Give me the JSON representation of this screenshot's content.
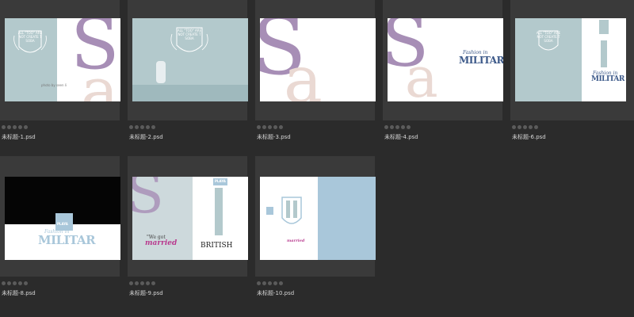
{
  "files": [
    {
      "name": "未标题-1.psd",
      "rating": 0
    },
    {
      "name": "未标题-2.psd",
      "rating": 0
    },
    {
      "name": "未标题-3.psd",
      "rating": 0
    },
    {
      "name": "未标题-4.psd",
      "rating": 0
    },
    {
      "name": "未标题-6.psd",
      "rating": 0
    },
    {
      "name": "未标题-8.psd",
      "rating": 0
    },
    {
      "name": "未标题-9.psd",
      "rating": 0
    },
    {
      "name": "未标题-10.psd",
      "rating": 0
    }
  ],
  "thumb_text": {
    "crest_line": "ALL \"TOO\" ARE NOT CREATE T SOBA",
    "military": "MILITAR",
    "fashion": "Fashion in",
    "playa": "PLAYA",
    "married": "married",
    "we_got": "\"We got",
    "british": "BRITISH",
    "photo_credit": "photo by seen li"
  },
  "colors": {
    "panel": "#3a3a3a",
    "background": "#2b2b2b",
    "sage": "#b3c9cc",
    "lilac": "#a78eb6",
    "peach": "#ead9d3",
    "navy": "#3d5a8a",
    "magenta": "#b83a8e",
    "sky": "#a9c7da"
  }
}
